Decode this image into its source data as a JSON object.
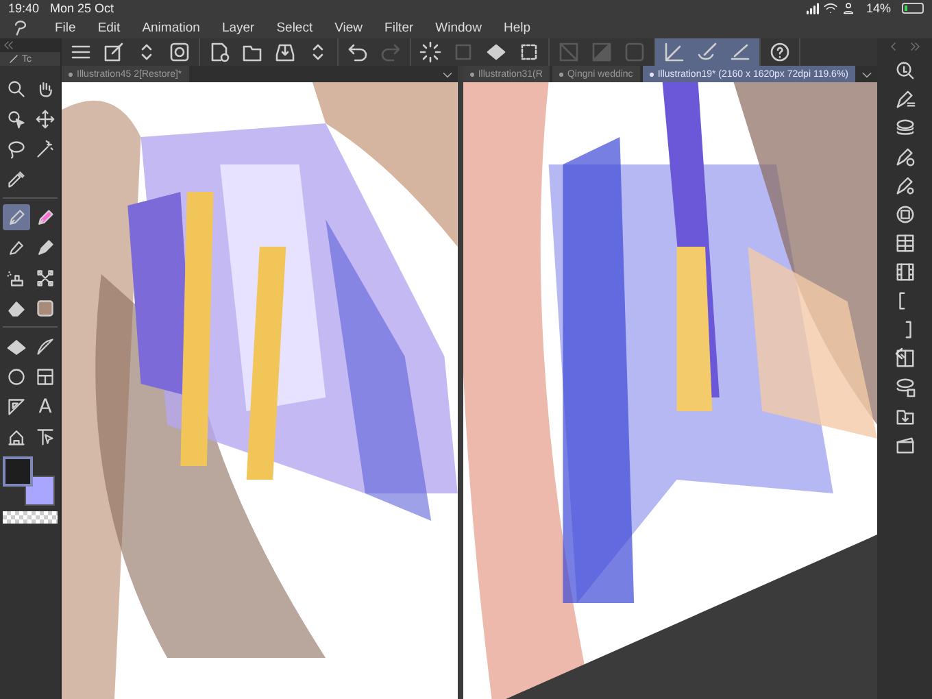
{
  "status_bar": {
    "time": "19:40",
    "date": "Mon 25 Oct",
    "battery": "14%"
  },
  "menu": [
    "File",
    "Edit",
    "Animation",
    "Layer",
    "Select",
    "View",
    "Filter",
    "Window",
    "Help"
  ],
  "toolbar_groups": [
    [
      {
        "selected": false,
        "disabled": false
      },
      {
        "selected": false,
        "disabled": false
      },
      {
        "selected": false,
        "disabled": false
      },
      {
        "selected": false,
        "disabled": false
      }
    ],
    [
      {
        "selected": false,
        "disabled": false
      },
      {
        "selected": false,
        "disabled": false
      },
      {
        "selected": false,
        "disabled": false
      },
      {
        "selected": false,
        "disabled": false
      }
    ],
    [
      {
        "selected": false,
        "disabled": false
      },
      {
        "selected": false,
        "disabled": true
      }
    ],
    [
      {
        "selected": false,
        "disabled": false
      },
      {
        "selected": false,
        "disabled": true
      },
      {
        "selected": false,
        "disabled": false
      },
      {
        "selected": false,
        "disabled": false
      }
    ],
    [
      {
        "selected": false,
        "disabled": true
      },
      {
        "selected": false,
        "disabled": true
      },
      {
        "selected": false,
        "disabled": true
      }
    ],
    [
      {
        "selected": true,
        "disabled": false
      },
      {
        "selected": true,
        "disabled": false
      },
      {
        "selected": true,
        "disabled": false
      }
    ],
    [
      {
        "selected": false,
        "disabled": false
      }
    ]
  ],
  "tool_panel": {
    "tab": "Tc"
  },
  "tool_groups": [
    [
      {
        "selected": false
      },
      {
        "selected": false
      },
      {
        "selected": false
      },
      {
        "selected": false
      },
      {
        "selected": false
      },
      {
        "selected": false
      },
      {
        "selected": false
      }
    ],
    [
      {
        "selected": true
      },
      {
        "selected": false
      },
      {
        "selected": false
      },
      {
        "selected": false
      },
      {
        "selected": false
      },
      {
        "selected": false
      },
      {
        "selected": false
      },
      {
        "selected": false
      }
    ],
    [
      {
        "selected": false
      },
      {
        "selected": false
      },
      {
        "selected": false
      },
      {
        "selected": false
      },
      {
        "selected": false
      },
      {
        "selected": false,
        "glyph": "A"
      },
      {
        "selected": false
      },
      {
        "selected": false
      }
    ]
  ],
  "color_swatches": [
    {
      "color": "#1e1e1e",
      "selected": true
    },
    {
      "color": "#a9a6ff",
      "selected": false
    }
  ],
  "left_pane": {
    "tabs": [
      {
        "label": "Illustration45 2[Restore]*",
        "selected": false
      }
    ]
  },
  "right_pane": {
    "tabs": [
      {
        "label": "Illustration31(R",
        "selected": false
      },
      {
        "label": "Qingni weddinc",
        "selected": false
      },
      {
        "label": "Illustration19* (2160 x 1620px 72dpi 119.6%)",
        "selected": true
      }
    ]
  }
}
